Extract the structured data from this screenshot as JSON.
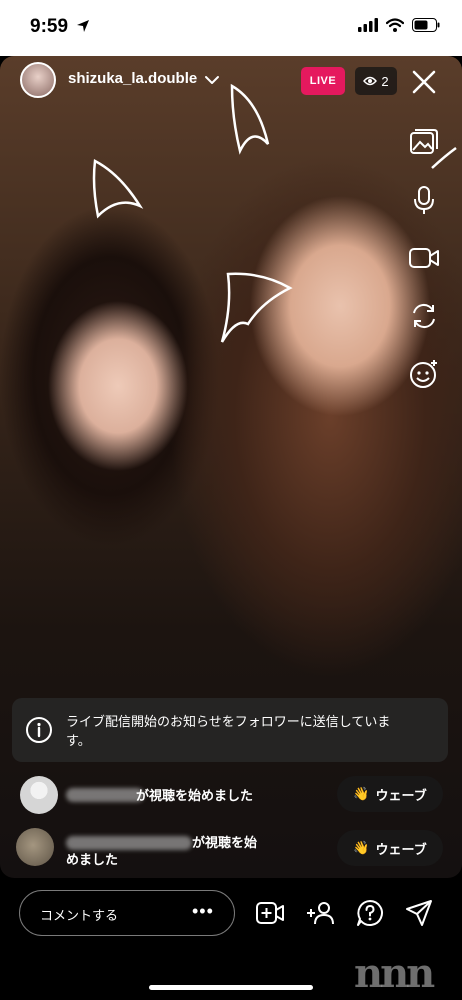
{
  "status_bar": {
    "time": "9:59"
  },
  "header": {
    "username": "shizuka_la.double",
    "live_label": "LIVE",
    "viewer_count": "2"
  },
  "side_tools": [
    "image-icon",
    "microphone-icon",
    "video-camera-icon",
    "switch-camera-icon",
    "face-effects-icon"
  ],
  "notice": {
    "text": "ライブ配信開始のお知らせをフォロワーに送信しています。"
  },
  "comments": [
    {
      "text": "が視聴を始めました",
      "wave_label": "ウェーブ"
    },
    {
      "text_line1": "が視聴を始",
      "text_line2": "めました",
      "wave_label": "ウェーブ"
    }
  ],
  "bottom_bar": {
    "comment_placeholder": "コメントする",
    "more": "•••",
    "icons": [
      "add-guest-icon",
      "add-person-icon",
      "question-icon",
      "send-icon"
    ]
  },
  "watermark": "nnn"
}
